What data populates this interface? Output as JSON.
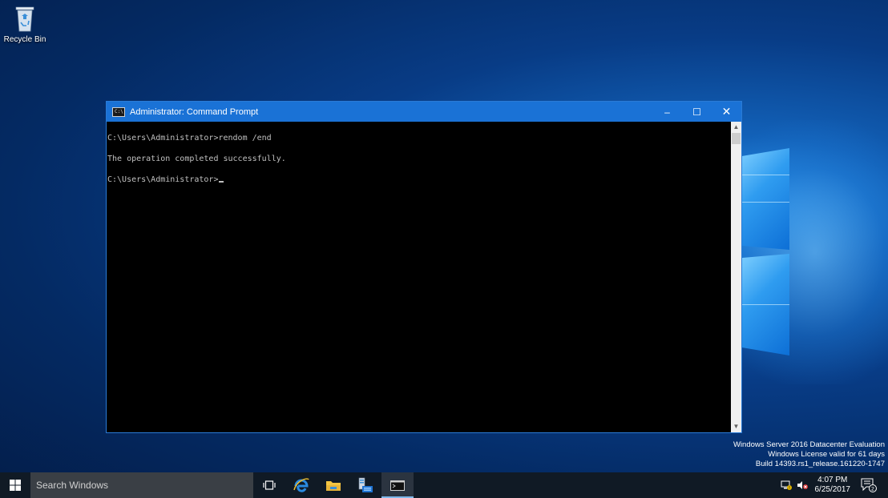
{
  "desktop": {
    "icons": [
      {
        "label": "Recycle Bin"
      }
    ]
  },
  "window": {
    "title": "Administrator: Command Prompt",
    "controls": {
      "minimize": "–",
      "maximize": "☐",
      "close": "✕"
    },
    "console_lines": [
      "C:\\Users\\Administrator>rendom /end",
      "",
      "The operation completed successfully.",
      "",
      "C:\\Users\\Administrator>"
    ]
  },
  "watermark": {
    "line1": "Windows Server 2016 Datacenter Evaluation",
    "line2": "Windows License valid for 61 days",
    "line3": "Build 14393.rs1_release.161220-1747"
  },
  "taskbar": {
    "search_placeholder": "Search Windows",
    "time": "4:07 PM",
    "date": "6/25/2017",
    "notification_count": "2"
  }
}
